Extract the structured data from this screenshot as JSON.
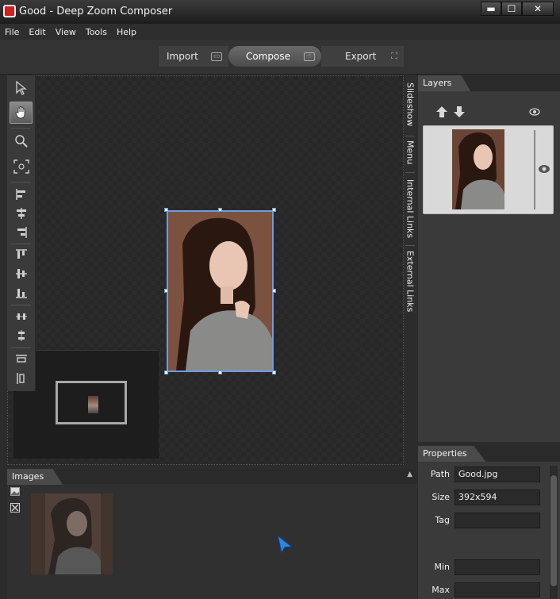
{
  "window": {
    "title": "Good - Deep Zoom Composer",
    "controls": {
      "minimize": "▬",
      "maximize": "☐",
      "close": "✕"
    }
  },
  "menu": [
    "File",
    "Edit",
    "View",
    "Tools",
    "Help"
  ],
  "modes": {
    "import_label": "Import",
    "compose_label": "Compose",
    "export_label": "Export",
    "active": "Compose"
  },
  "toolbar": {
    "tools": [
      "select-arrow-icon",
      "pan-hand-icon",
      "zoom-icon",
      "fit-to-screen-icon",
      "align-left-icon",
      "align-center-icon",
      "align-right-icon",
      "align-top-icon",
      "align-middle-icon",
      "align-bottom-icon",
      "distribute-horizontal-icon",
      "distribute-vertical-icon",
      "resize-width-icon",
      "resize-height-icon"
    ],
    "active": "pan-hand-icon"
  },
  "side_tabs": [
    "Slideshow",
    "Menu",
    "Internal Links",
    "External Links"
  ],
  "layers": {
    "header": "Layers",
    "icons": [
      "move-up-icon",
      "move-down-icon",
      "visibility-eye-icon"
    ]
  },
  "properties": {
    "header": "Properties",
    "rows": [
      {
        "label": "Path",
        "value": "Good.jpg"
      },
      {
        "label": "Size",
        "value": "392x594"
      },
      {
        "label": "Tag",
        "value": ""
      },
      {
        "label": "Min",
        "value": ""
      },
      {
        "label": "Max",
        "value": ""
      }
    ]
  },
  "images_panel": {
    "header": "Images"
  },
  "colors": {
    "accent_selection": "#6f9be0",
    "background": "#2c2c2c",
    "panel": "#3a3a3a"
  }
}
